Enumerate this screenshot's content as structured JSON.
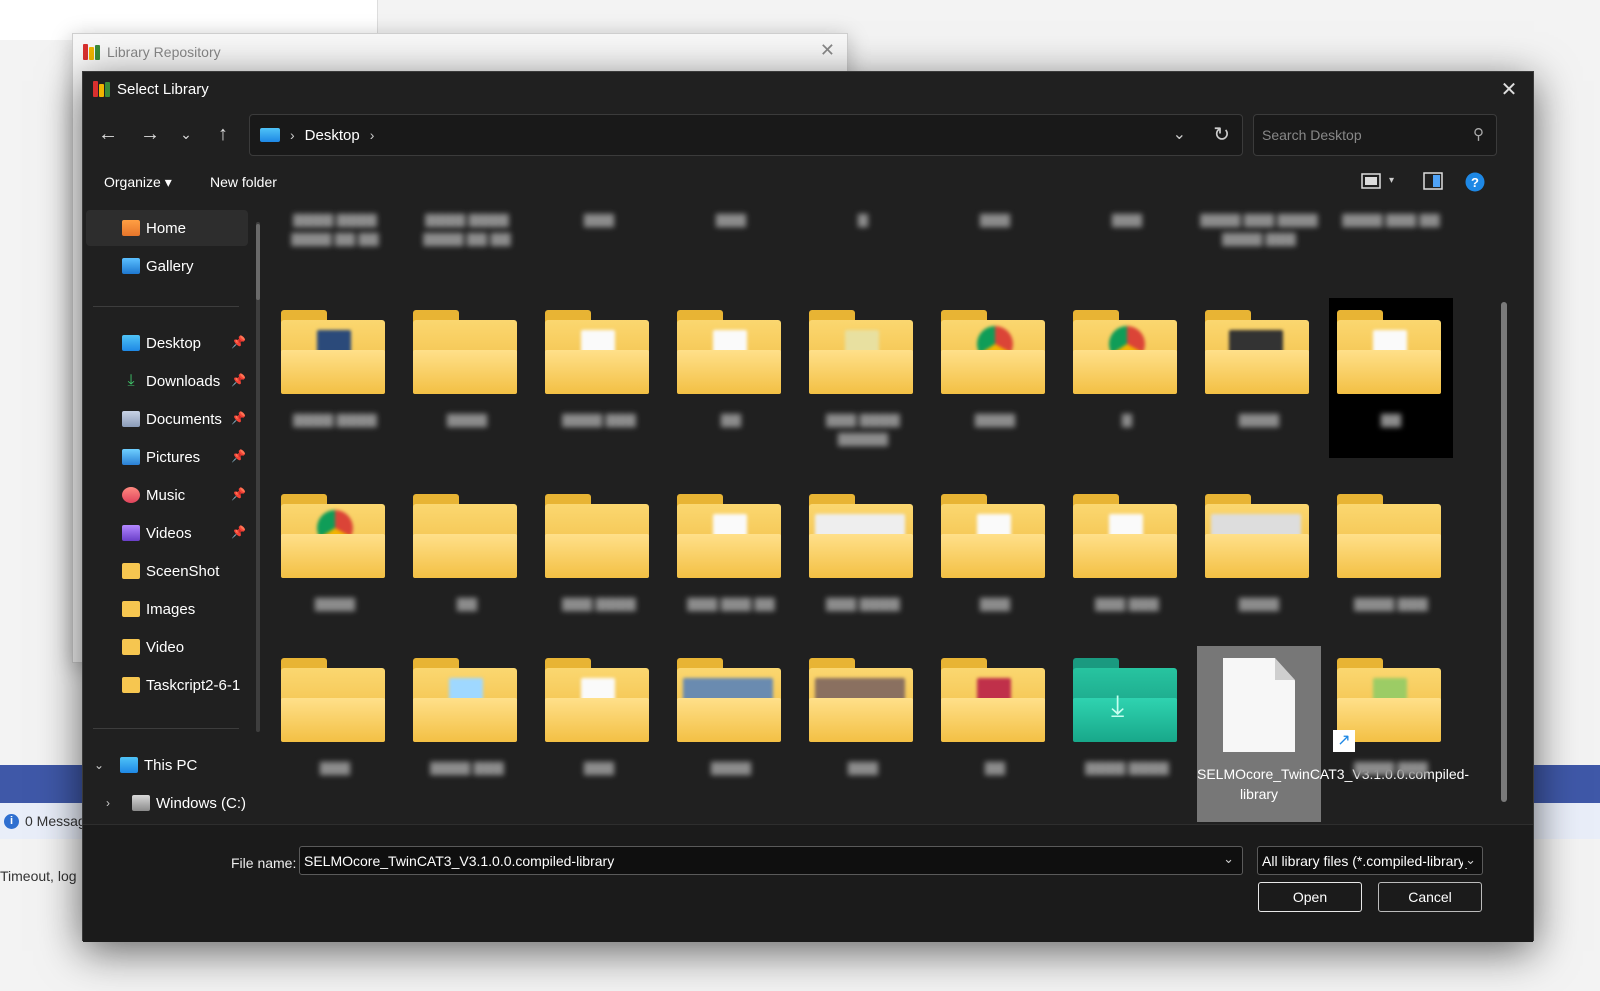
{
  "background": {
    "repo_window_title": "Library Repository",
    "message_count_text": "0 Messag",
    "log_text": "Timeout, log"
  },
  "dialog": {
    "title": "Select Library",
    "address": {
      "crumb": "Desktop",
      "search_placeholder": "Search Desktop"
    },
    "toolbar": {
      "organize": "Organize ▾",
      "new_folder": "New folder"
    },
    "sidebar": {
      "quick": [
        "Home",
        "Gallery"
      ],
      "pinned": [
        "Desktop",
        "Downloads",
        "Documents",
        "Pictures",
        "Music",
        "Videos"
      ],
      "folders": [
        "SceenShot",
        "Images",
        "Video",
        "Taskcript2-6-1"
      ],
      "tree": [
        "This PC",
        "Windows (C:)"
      ]
    },
    "selected_file_label": "SELMOcore_TwinCAT3_V3.1.0.0.compiled-library",
    "file_name_label": "File name:",
    "file_name_value": "SELMOcore_TwinCAT3_V3.1.0.0.compiled-library",
    "file_type_value": "All library files (*.compiled-library)",
    "open_label": "Open",
    "cancel_label": "Cancel"
  },
  "colors": {
    "dialog_bg": "#202020",
    "folder": "#f6c650",
    "selected_tile": "#777777",
    "accent_blue": "#1e88e5"
  }
}
